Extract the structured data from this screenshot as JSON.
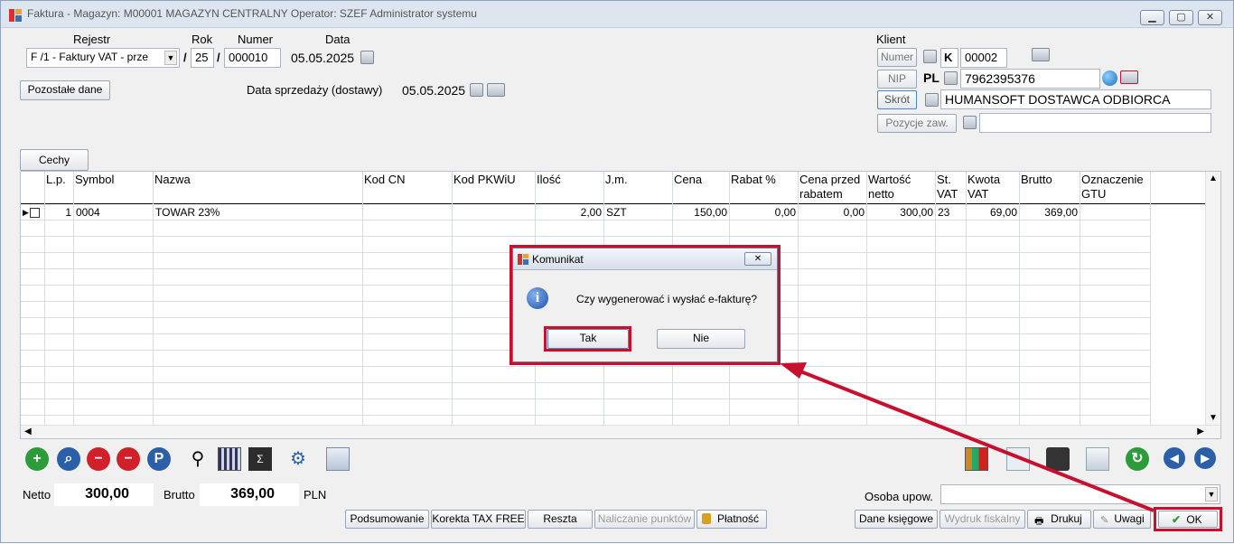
{
  "window": {
    "title": "Faktura - Magazyn: M00001 MAGAZYN CENTRALNY  Operator: SZEF Administrator systemu",
    "min_label": "▁",
    "max_label": "▢",
    "close_label": "✕"
  },
  "header": {
    "rejestr_label": "Rejestr",
    "rok_label": "Rok",
    "numer_label": "Numer",
    "data_label": "Data",
    "rejestr_value": "F /1   - Faktury VAT - prze",
    "slash1": "/",
    "rok_value": "25",
    "slash2": "/",
    "numer_value": "000010",
    "data_value": "05.05.2025",
    "pozostale_button": "Pozostałe dane",
    "data_sprzedazy_label": "Data sprzedaży (dostawy)",
    "data_sprzedazy_value": "05.05.2025"
  },
  "client": {
    "title": "Klient",
    "numer_button": "Numer",
    "k_label": "K",
    "numer_value": "00002",
    "nip_button": "NIP",
    "pl_label": "PL",
    "nip_value": "7962395376",
    "skrot_button": "Skrót",
    "skrot_value": "HUMANSOFT DOSTAWCA ODBIORCA",
    "pozycje_button": "Pozycje zaw.",
    "pozycje_value": ""
  },
  "cechy_tab": "Cechy",
  "table": {
    "columns": [
      "L.p.",
      "Symbol",
      "Nazwa",
      "Kod  CN",
      "Kod  PKWiU",
      "Ilość",
      "J.m.",
      "Cena",
      "Rabat %",
      "Cena przed rabatem",
      "Wartość netto",
      "St. VAT",
      "Kwota VAT",
      "Brutto",
      "Oznaczenie GTU"
    ],
    "rows": [
      {
        "lp": "1",
        "symbol": "0004",
        "nazwa": "TOWAR 23%",
        "kod_cn": "",
        "kod_pkwiu": "",
        "ilosc": "2,00",
        "jm": "SZT",
        "cena": "150,00",
        "rabat": "0,00",
        "cena_przed": "0,00",
        "wartosc_netto": "300,00",
        "st_vat": "23",
        "kwota_vat": "69,00",
        "brutto": "369,00",
        "gtu": ""
      }
    ]
  },
  "totals": {
    "netto_label": "Netto",
    "netto_value": "300,00",
    "brutto_label": "Brutto",
    "brutto_value": "369,00",
    "currency": "PLN",
    "osoba_label": "Osoba upow."
  },
  "bottom_buttons": {
    "podsumowanie": "Podsumowanie",
    "korekta": "Korekta TAX FREE",
    "reszta": "Reszta",
    "naliczanie": "Naliczanie punktów",
    "platnosc": "Płatność",
    "dane_ksiegowe": "Dane księgowe",
    "wydruk_fiskalny": "Wydruk fiskalny",
    "drukuj": "Drukuj",
    "uwagi": "Uwagi",
    "ok": "OK"
  },
  "dialog": {
    "title": "Komunikat",
    "close_label": "✕",
    "message": "Czy wygenerować i wysłać e-fakturę?",
    "tak": "Tak",
    "nie": "Nie"
  },
  "colors": {
    "accent_red": "#c8102e",
    "title_bg": "#dde6f0"
  }
}
